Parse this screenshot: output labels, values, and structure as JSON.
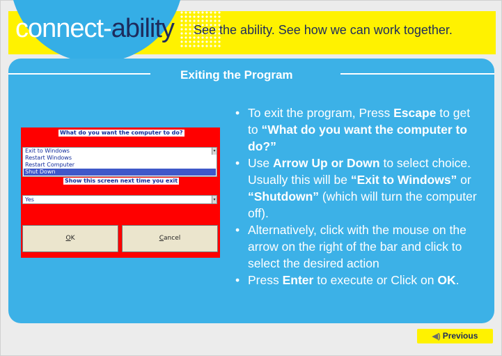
{
  "header": {
    "logo_part1": "connect-",
    "logo_part2": "ability",
    "tagline": "See the ability. See how we can work together."
  },
  "slide": {
    "title": "Exiting the Program"
  },
  "dialog": {
    "question": "What do you want the computer to do?",
    "options": [
      "Exit to Windows",
      "Restart Windows",
      "Restart Computer",
      "Shut Down"
    ],
    "selected_index": 3,
    "show_label": "Show this screen next time you exit",
    "show_value": "Yes",
    "ok_label_u": "O",
    "ok_label_rest": "K",
    "cancel_label_u": "C",
    "cancel_label_rest": "ancel"
  },
  "bullets": [
    {
      "parts": [
        {
          "t": "To exit the program, Press ",
          "b": false
        },
        {
          "t": "Escape",
          "b": true
        },
        {
          "t": " to get to ",
          "b": false
        },
        {
          "t": "“What do you want the computer to do?”",
          "b": true
        }
      ]
    },
    {
      "parts": [
        {
          "t": "Use ",
          "b": false
        },
        {
          "t": "Arrow Up or Down",
          "b": true
        },
        {
          "t": " to select choice.  Usually this will be ",
          "b": false
        },
        {
          "t": "“Exit to Windows”",
          "b": true
        },
        {
          "t": " or ",
          "b": false
        },
        {
          "t": "“Shutdown”",
          "b": true
        },
        {
          "t": " (which will turn the computer off).",
          "b": false
        }
      ]
    },
    {
      "parts": [
        {
          "t": "Alternatively, click with the mouse on the arrow on the right of the bar and click to select the desired action",
          "b": false
        }
      ]
    },
    {
      "parts": [
        {
          "t": "Press ",
          "b": false
        },
        {
          "t": "Enter",
          "b": true
        },
        {
          "t": " to execute or Click on ",
          "b": false
        },
        {
          "t": "OK",
          "b": true
        },
        {
          "t": ".",
          "b": false
        }
      ]
    }
  ],
  "nav": {
    "previous_label": "Previous",
    "previous_icon": "speaker-icon"
  },
  "colors": {
    "yellow": "#fff200",
    "blue": "#3cb1e7",
    "navy": "#1d2b5c",
    "dialog_red": "#ff0000"
  }
}
